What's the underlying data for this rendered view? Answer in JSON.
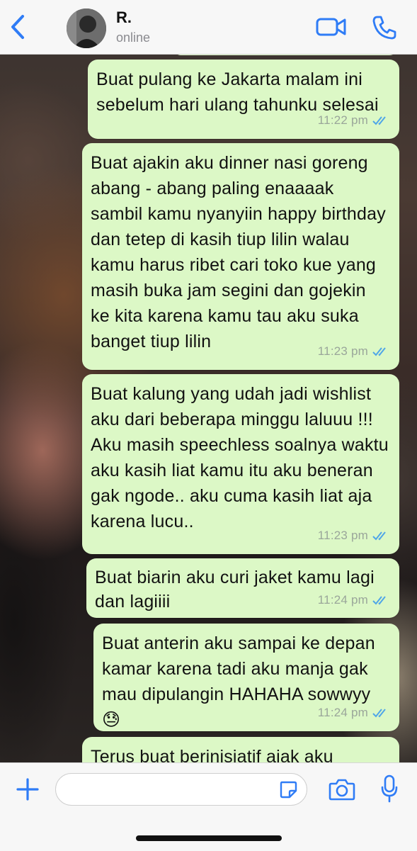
{
  "header": {
    "name": "R.",
    "status": "online"
  },
  "messages": [
    {
      "text": "Buat pulang ke Jakarta malam ini sebelum hari ulang tahunku selesai",
      "time": "11:22 pm"
    },
    {
      "text": "Buat ajakin aku dinner nasi goreng abang - abang paling enaaaak sambil kamu nyanyiin happy birthday dan tetep di kasih tiup lilin walau kamu harus ribet cari toko kue yang masih buka jam segini dan gojekin ke kita karena kamu tau aku suka banget tiup lilin",
      "time": "11:23 pm"
    },
    {
      "text": "Buat kalung yang udah jadi wishlist aku dari beberapa minggu laluuu !!! Aku masih speechless soalnya waktu aku kasih liat kamu itu aku beneran gak ngode.. aku cuma kasih liat aja karena lucu..",
      "time": "11:23 pm"
    },
    {
      "text": "Buat biarin aku curi jaket kamu lagi dan lagiiii",
      "time": "11:24 pm"
    },
    {
      "text": "Buat anterin aku sampai ke depan kamar karena tadi aku manja gak mau dipulangin HAHAHA sowwyy 😓",
      "time": "11:24 pm"
    },
    {
      "text": "Terus buat berinisiatif ajak aku",
      "time": ""
    }
  ],
  "input": {
    "placeholder": ""
  },
  "colors": {
    "bubble": "#dcf8c6",
    "accent": "#2f7cf6",
    "header_bg": "#f7f7f7"
  },
  "icons": {
    "back": "chevron-left-icon",
    "video": "video-camera-icon",
    "call": "phone-icon",
    "plus": "plus-icon",
    "sticker": "sticker-icon",
    "camera": "camera-icon",
    "mic": "microphone-icon",
    "read": "double-check-icon"
  }
}
